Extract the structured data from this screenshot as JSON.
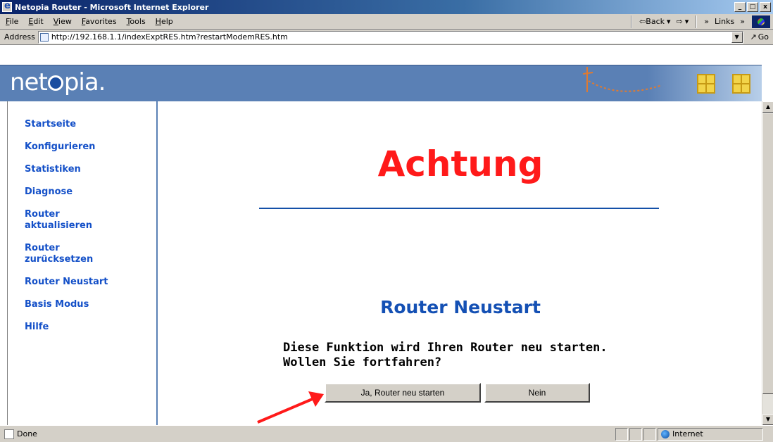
{
  "window": {
    "title": "Netopia Router - Microsoft Internet Explorer",
    "minimize": "_",
    "maximize": "□",
    "close": "x"
  },
  "menu": {
    "items": [
      "File",
      "Edit",
      "View",
      "Favorites",
      "Tools",
      "Help"
    ]
  },
  "toolbar": {
    "back_label": "⇦Back",
    "forward_label": "⇨",
    "more_label": "»",
    "links_label": "Links"
  },
  "address": {
    "label": "Address",
    "url": "http://192.168.1.1/indexExptRES.htm?restartModemRES.htm",
    "go_label": "Go"
  },
  "brand": {
    "logo_prefix": "net",
    "logo_suffix": "pia."
  },
  "sidebar": {
    "items": [
      {
        "label": "Startseite"
      },
      {
        "label": "Konfigurieren"
      },
      {
        "label": "Statistiken"
      },
      {
        "label": "Diagnose"
      },
      {
        "label": "Router aktualisieren"
      },
      {
        "label": "Router zurücksetzen"
      },
      {
        "label": "Router Neustart"
      },
      {
        "label": "Basis Modus"
      },
      {
        "label": "Hilfe"
      }
    ]
  },
  "main": {
    "headline": "Achtung",
    "section_title": "Router Neustart",
    "prompt": "Diese Funktion wird Ihren Router neu starten. Wollen Sie fortfahren?",
    "confirm_label": "Ja, Router neu starten",
    "cancel_label": "Nein"
  },
  "status": {
    "text": "Done",
    "zone": "Internet"
  },
  "colors": {
    "headline": "#ff1a1a",
    "nav_link": "#1450c8",
    "header_bg": "#5a80b5",
    "arrow": "#ff1a1a"
  }
}
